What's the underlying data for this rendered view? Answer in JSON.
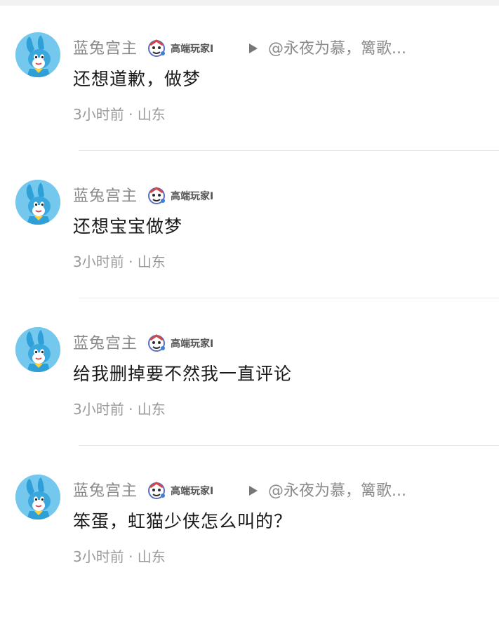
{
  "comments": [
    {
      "username": "蓝兔宫主",
      "badge": "高端玩家I",
      "reply_to": "@永夜为慕，篱歌...",
      "text": "还想道歉，做梦",
      "meta": "3小时前 · 山东"
    },
    {
      "username": "蓝兔宫主",
      "badge": "高端玩家I",
      "reply_to": "",
      "text": "还想宝宝做梦",
      "meta": "3小时前 · 山东"
    },
    {
      "username": "蓝兔宫主",
      "badge": "高端玩家I",
      "reply_to": "",
      "text": "给我删掉要不然我一直评论",
      "meta": "3小时前 · 山东"
    },
    {
      "username": "蓝兔宫主",
      "badge": "高端玩家I",
      "reply_to": "@永夜为慕，篱歌...",
      "text": "笨蛋，虹猫少侠怎么叫的？",
      "meta": "3小时前 · 山东"
    }
  ],
  "icons": {
    "avatar": "blue-rabbit-avatar-icon",
    "badge": "player-level-badge-icon",
    "reply": "reply-arrow-icon"
  },
  "colors": {
    "avatar_bg": "#74c8ee",
    "username": "#8a8a8a",
    "content": "#1a1a1a",
    "meta": "#999999"
  }
}
